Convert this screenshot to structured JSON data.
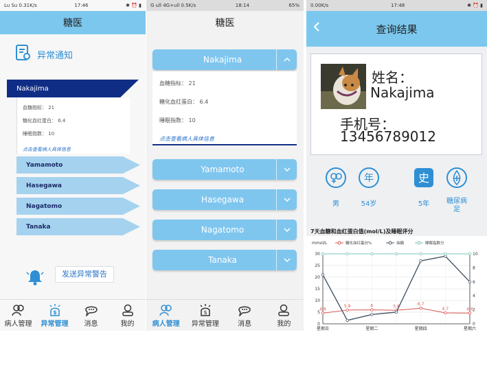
{
  "phone1": {
    "status_left": "Lu Su 0.31K/s",
    "status_time": "17:46",
    "title": "糖医",
    "section_title": "异常通知",
    "expanded": {
      "name": "Nakajima",
      "lines": [
        "血糖指标： 21",
        "糖化血红蛋白： 6.4",
        "睡眠指数： 10"
      ],
      "link": "点击查看病人具体信息"
    },
    "items": [
      "Yamamoto",
      "Hasegawa",
      "Nagatomo",
      "Tanaka"
    ],
    "send_button": "发送异常警告",
    "nav": [
      "病人管理",
      "异常管理",
      "消息",
      "我的"
    ],
    "active_nav": 1
  },
  "phone2": {
    "status_left": "G ull 4G+ull 0.5K/s",
    "status_time": "18:14",
    "status_right": "65%",
    "title": "糖医",
    "expanded": {
      "name": "Nakajima",
      "lines": [
        "血糖指标： 21",
        "糖化血红蛋白： 6.4",
        "睡眠指数： 10"
      ],
      "link": "点击查看病人具体信息"
    },
    "items": [
      "Yamamoto",
      "Hasegawa",
      "Nagatomo",
      "Tanaka"
    ],
    "nav": [
      "病人管理",
      "异常管理",
      "消息",
      "我的"
    ],
    "active_nav": 0
  },
  "phone3": {
    "status_left": "0.00K/s",
    "status_time": "17:48",
    "title": "查询结果",
    "name_label": "姓名：",
    "name_value": "Nakajima",
    "phone_label": "手机号：",
    "phone_value": "13456789012",
    "stats": [
      {
        "icon": "gender-icon",
        "label": "男"
      },
      {
        "icon": "age-icon",
        "label": "54岁"
      },
      {
        "icon": "history-icon",
        "label": "5年"
      },
      {
        "icon": "diabetes-icon",
        "label": "糖尿病足"
      }
    ],
    "icon_glyphs": {
      "age": "年",
      "history": "史"
    },
    "chart_title": "7天血糖和血红蛋白值(mol/L)及睡眠评分",
    "legend": [
      "mmol/L",
      "糖化血红蛋白%",
      "血糖",
      "睡眠指数分"
    ],
    "colors": {
      "primary": "#7cc7ee",
      "accent": "#2f8fd4",
      "dark": "#102d86",
      "glycated": "#d9534f",
      "glucose": "#445566",
      "sleep": "#77c4b8"
    }
  },
  "chart_data": {
    "type": "line",
    "title": "7天血糖和血红蛋白值(mol/L)及睡眠评分",
    "categories": [
      "星期日",
      "星期二",
      "星期四",
      "星期六"
    ],
    "x_index": [
      0,
      1,
      2,
      3,
      4,
      5,
      6
    ],
    "ylim": [
      0,
      30
    ],
    "y_ticks": [
      0,
      5,
      10,
      15,
      20,
      25,
      30
    ],
    "y2lim": [
      0,
      10
    ],
    "y2_ticks": [
      0,
      2,
      4,
      6,
      8,
      10
    ],
    "series": [
      {
        "name": "糖化血红蛋白%",
        "axis": "left",
        "values": [
          4.6,
          5.9,
          6,
          5.8,
          6.7,
          4.7,
          4.6
        ],
        "labels": [
          "4.6",
          "5.9",
          "6",
          "5.8",
          "6.7",
          "4.7",
          "4.6"
        ]
      },
      {
        "name": "血糖",
        "axis": "left",
        "values": [
          21,
          1.5,
          4,
          5,
          27,
          29,
          18
        ]
      },
      {
        "name": "睡眠指数分",
        "axis": "right",
        "values": [
          10,
          10,
          10,
          10,
          10,
          10,
          10
        ]
      }
    ],
    "grid": true,
    "legend_position": "top"
  }
}
